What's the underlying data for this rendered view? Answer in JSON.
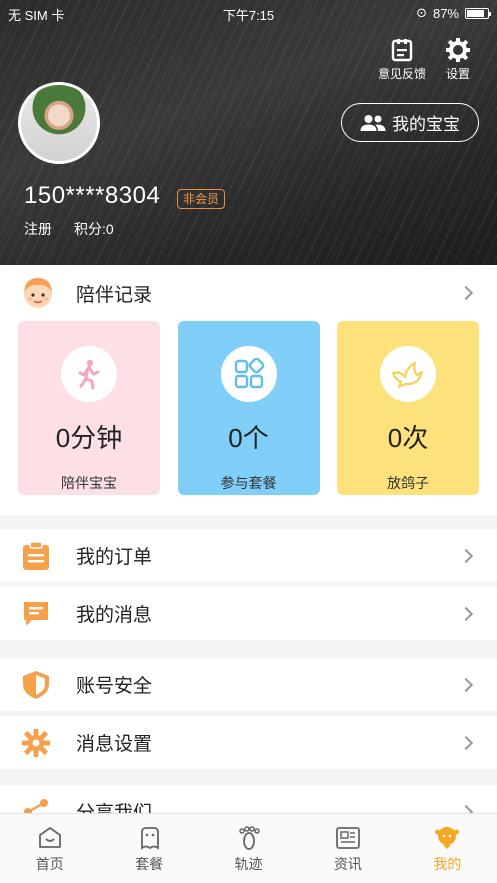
{
  "status_bar": {
    "carrier": "无 SIM 卡",
    "time": "下午7:15",
    "battery": "87%",
    "battery_level": 0.87
  },
  "header": {
    "feedback_label": "意见反馈",
    "settings_label": "设置",
    "my_baby_button": "我的宝宝",
    "phone": "150****8304",
    "member_badge": "非会员",
    "register_label": "注册",
    "points_label": "积分:0"
  },
  "companion": {
    "title": "陪伴记录",
    "stats": [
      {
        "value": "0分钟",
        "label": "陪伴宝宝",
        "color": "#fde0e6",
        "icon": "running-child-icon"
      },
      {
        "value": "0个",
        "label": "参与套餐",
        "color": "#80cff9",
        "icon": "grid-apps-icon"
      },
      {
        "value": "0次",
        "label": "放鸽子",
        "color": "#fde17a",
        "icon": "dove-icon"
      }
    ]
  },
  "menu": {
    "orders": "我的订单",
    "messages": "我的消息",
    "account_security": "账号安全",
    "message_settings": "消息设置",
    "share": "分享我们"
  },
  "tabs": [
    {
      "label": "首页",
      "icon": "home-icon"
    },
    {
      "label": "套餐",
      "icon": "package-icon"
    },
    {
      "label": "轨迹",
      "icon": "footprint-icon"
    },
    {
      "label": "资讯",
      "icon": "news-icon"
    },
    {
      "label": "我的",
      "icon": "profile-icon",
      "active": true
    }
  ],
  "colors": {
    "accent": "#f5a623",
    "menu_icon": "#f7a04b"
  }
}
